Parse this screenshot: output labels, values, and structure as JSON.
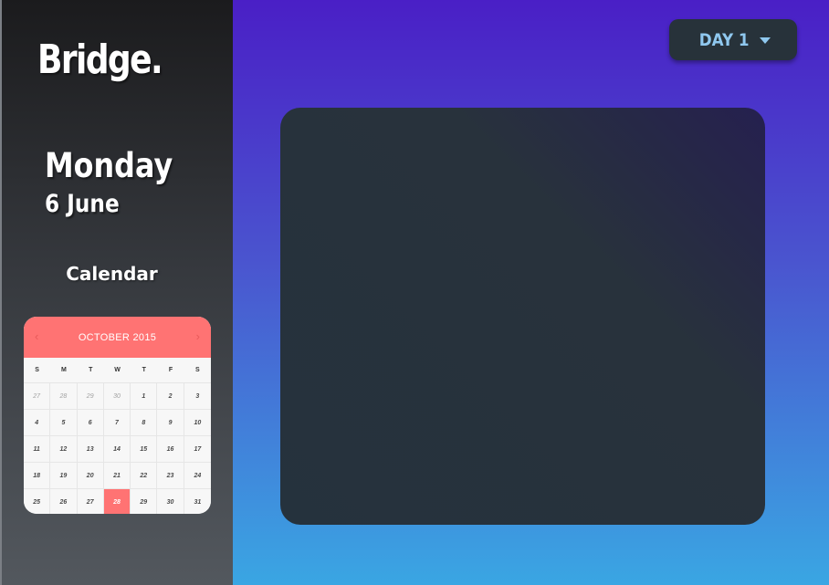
{
  "sidebar": {
    "logo": "Bridge.",
    "day_name": "Monday",
    "date": "6 June",
    "calendar_heading": "Calendar"
  },
  "calendar": {
    "month_label": "OCTOBER 2015",
    "prev_arrow": "‹",
    "next_arrow": "›",
    "weekdays": [
      "S",
      "M",
      "T",
      "W",
      "T",
      "F",
      "S"
    ],
    "weeks": [
      [
        "27",
        "28",
        "29",
        "30",
        "1",
        "2",
        "3"
      ],
      [
        "4",
        "5",
        "6",
        "7",
        "8",
        "9",
        "10"
      ],
      [
        "11",
        "12",
        "13",
        "14",
        "15",
        "16",
        "17"
      ],
      [
        "18",
        "19",
        "20",
        "21",
        "22",
        "23",
        "24"
      ],
      [
        "25",
        "26",
        "27",
        "28",
        "29",
        "30",
        "31"
      ]
    ],
    "selected_day": "28"
  },
  "header": {
    "day_selector_label": "DAY 1"
  },
  "colors": {
    "accent_coral": "#ff7373",
    "button_text": "#8fc8ef",
    "panel_bg": "#27323a"
  }
}
